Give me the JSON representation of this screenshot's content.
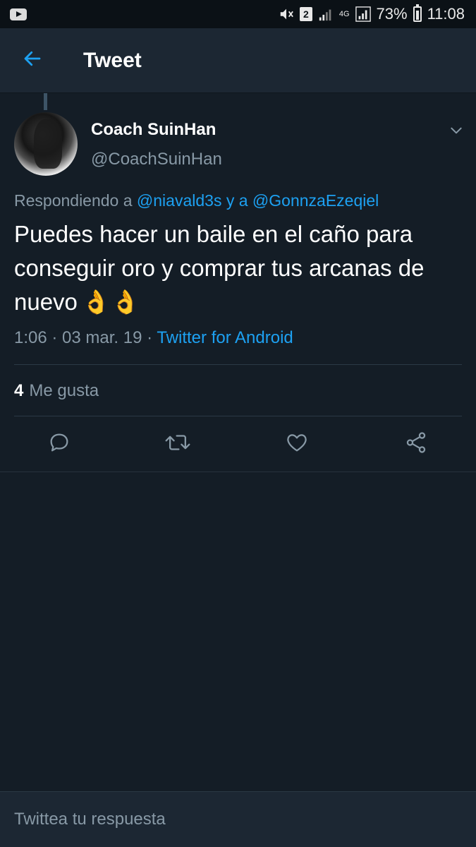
{
  "status_bar": {
    "left_icons": [
      "youtube-icon"
    ],
    "right_icons": [
      "mute-icon",
      "sim-2-icon",
      "signal-icon",
      "4g-icon",
      "signal-icon"
    ],
    "sim_label": "2",
    "network_label": "4G",
    "battery": "73%",
    "time": "11:08"
  },
  "header": {
    "back_icon": "arrow-left-icon",
    "title": "Tweet"
  },
  "tweet": {
    "display_name": "Coach SuinHan",
    "handle": "@CoachSuinHan",
    "reply_prefix": "Respondiendo a ",
    "reply_mention_1": "@niavald3s",
    "reply_joiner": " y a ",
    "reply_mention_2": "@GonnzaEzeqiel",
    "text": "Puedes hacer un baile en el caño para conseguir oro y comprar tus arcanas de nuevo",
    "emoji": "👌👌",
    "timestamp": "1:06 · 03 mar. 19 · ",
    "source": "Twitter for Android",
    "likes_count": "4",
    "likes_label": "Me gusta"
  },
  "actions": [
    "reply-icon",
    "retweet-icon",
    "like-icon",
    "share-icon"
  ],
  "composer": {
    "placeholder": "Twittea tu respuesta"
  },
  "colors": {
    "background": "#141d26",
    "header": "#1c2733",
    "accent": "#1da1f2",
    "muted_text": "#8899a6"
  }
}
